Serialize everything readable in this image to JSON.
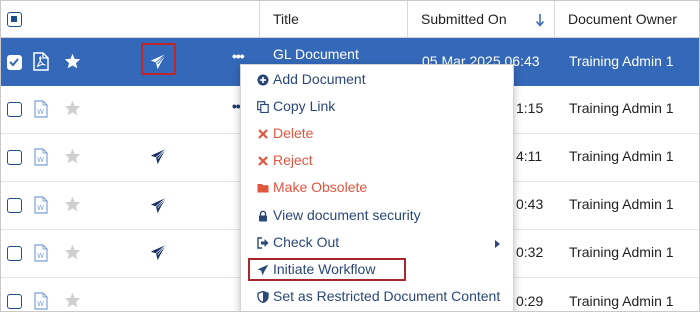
{
  "header": {
    "title_col": "Title",
    "submitted_col": "Submitted On",
    "owner_col": "Document Owner"
  },
  "rows": [
    {
      "title": "GL Document",
      "date": "05 Mar 2025 06:43",
      "owner": "Training Admin 1",
      "file_type": "pdf",
      "starred": true,
      "workflow": true,
      "selected": true
    },
    {
      "title": "",
      "date": "1:15",
      "owner": "Training Admin 1",
      "file_type": "word",
      "starred": false,
      "workflow": false,
      "selected": false
    },
    {
      "title": "",
      "date": "4:11",
      "owner": "Training Admin 1",
      "file_type": "word",
      "starred": false,
      "workflow": true,
      "selected": false
    },
    {
      "title": "",
      "date": "0:43",
      "owner": "Training Admin 1",
      "file_type": "word",
      "starred": false,
      "workflow": true,
      "selected": false
    },
    {
      "title": "",
      "date": "0:32",
      "owner": "Training Admin 1",
      "file_type": "word",
      "starred": false,
      "workflow": true,
      "selected": false
    },
    {
      "title": "",
      "date": "0:29",
      "owner": "Training Admin 1",
      "file_type": "word",
      "starred": false,
      "workflow": false,
      "selected": false
    }
  ],
  "menu": {
    "items": [
      {
        "label": "Add Document",
        "icon": "plus-circle-icon",
        "style": "normal"
      },
      {
        "label": "Copy Link",
        "icon": "copy-icon",
        "style": "normal"
      },
      {
        "label": "Delete",
        "icon": "x-icon",
        "style": "danger"
      },
      {
        "label": "Reject",
        "icon": "x-icon",
        "style": "danger"
      },
      {
        "label": "Make Obsolete",
        "icon": "folder-icon",
        "style": "danger"
      },
      {
        "label": "View document security",
        "icon": "lock-icon",
        "style": "normal"
      },
      {
        "label": "Check Out",
        "icon": "sign-out-icon",
        "style": "normal",
        "submenu": true
      },
      {
        "label": "Initiate Workflow",
        "icon": "paper-plane-icon",
        "style": "normal",
        "highlighted": true
      },
      {
        "label": "Set as Restricted Document Content",
        "icon": "shield-icon",
        "style": "normal"
      }
    ]
  },
  "colors": {
    "selected_row": "#3468b8",
    "menu_text": "#2a4778",
    "danger_text": "#e2553f",
    "highlight_border": "#c0272d",
    "icon_navy": "#1a2f66"
  }
}
